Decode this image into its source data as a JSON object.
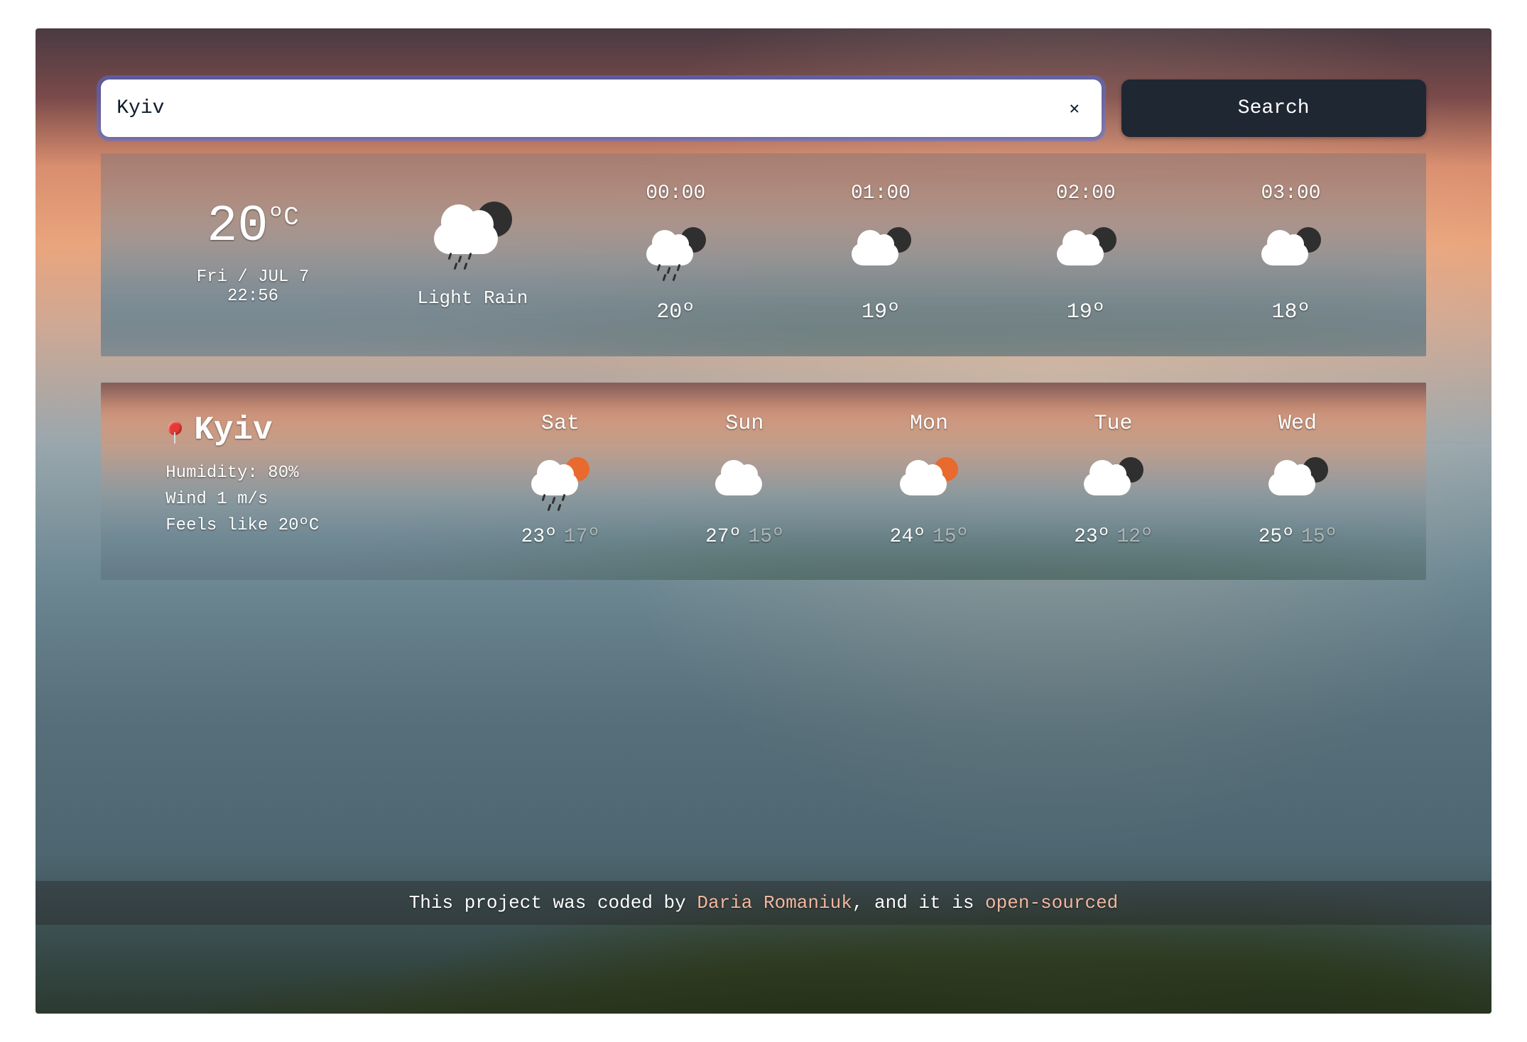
{
  "search": {
    "value": "Kyiv",
    "button": "Search"
  },
  "current": {
    "temp": "20",
    "unit": "ºC",
    "date": "Fri / JUL 7",
    "time": "22:56",
    "condition": "Light Rain",
    "condition_icon": "rain-dark"
  },
  "hourly": [
    {
      "time": "00:00",
      "icon": "rain-dark",
      "temp": "20º"
    },
    {
      "time": "01:00",
      "icon": "overcast-dark",
      "temp": "19º"
    },
    {
      "time": "02:00",
      "icon": "overcast-dark",
      "temp": "19º"
    },
    {
      "time": "03:00",
      "icon": "overcast-dark",
      "temp": "18º"
    }
  ],
  "city": {
    "name": "Kyiv",
    "humidity_label": "Humidity:",
    "humidity_value": "80%",
    "wind_label": "Wind",
    "wind_value": "1 m/s",
    "feels_label": "Feels like",
    "feels_value": "20ºC"
  },
  "daily": [
    {
      "day": "Sat",
      "icon": "rain-sun",
      "hi": "23º",
      "lo": "17º"
    },
    {
      "day": "Sun",
      "icon": "cloud",
      "hi": "27º",
      "lo": "15º"
    },
    {
      "day": "Mon",
      "icon": "cloud-sun",
      "hi": "24º",
      "lo": "15º"
    },
    {
      "day": "Tue",
      "icon": "overcast-dark",
      "hi": "23º",
      "lo": "12º"
    },
    {
      "day": "Wed",
      "icon": "overcast-dark",
      "hi": "25º",
      "lo": "15º"
    }
  ],
  "footer": {
    "text_1": "This project was coded by ",
    "author": "Daria Romaniuk",
    "text_2": ", and it is ",
    "link": "open-sourced"
  }
}
